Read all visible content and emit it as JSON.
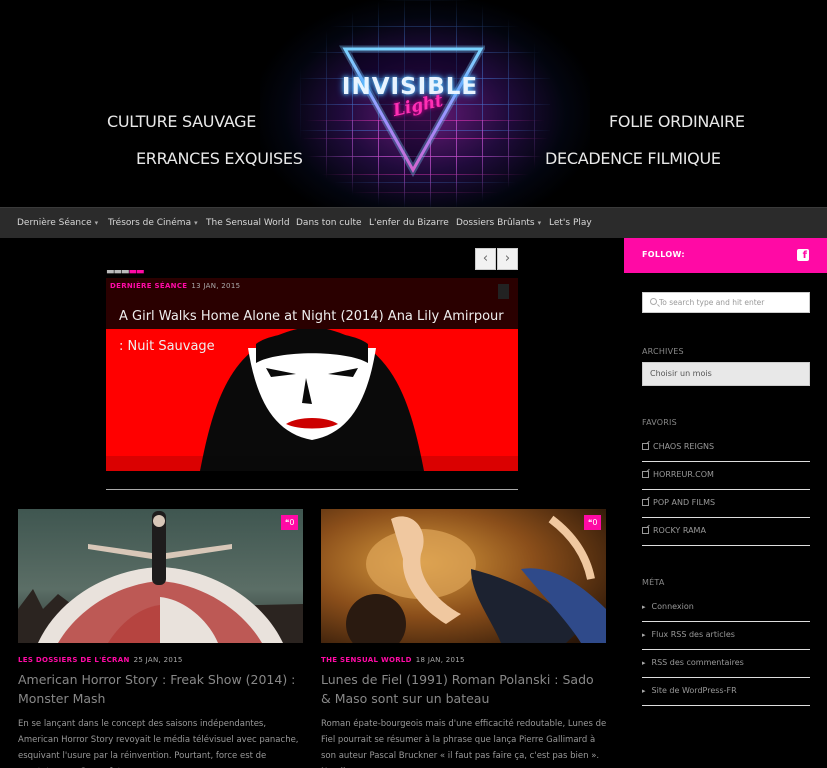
{
  "header": {
    "logo_title": "INVISIBLE",
    "logo_sub": "Light",
    "taglines": {
      "left_top": "CULTURE SAUVAGE",
      "left_bottom": "ERRANCES EXQUISES",
      "right_top": "FOLIE ORDINAIRE",
      "right_bottom": "DECADENCE FILMIQUE"
    }
  },
  "nav": {
    "items": [
      {
        "label": "Dernière Séance",
        "has_dropdown": true
      },
      {
        "label": "Trésors de Cinéma",
        "has_dropdown": true
      },
      {
        "label": "The Sensual World",
        "has_dropdown": false
      },
      {
        "label": "Dans ton culte",
        "has_dropdown": false
      },
      {
        "label": "L'enfer du Bizarre",
        "has_dropdown": false
      },
      {
        "label": "Dossiers Brûlants",
        "has_dropdown": true
      },
      {
        "label": "Let's Play",
        "has_dropdown": false
      }
    ],
    "caret": "▾"
  },
  "slider": {
    "prev_icon": "‹",
    "next_icon": "›",
    "slide": {
      "category": "DERNIÈRE SÉANCE",
      "date": "13 JAN, 2015",
      "title": "A Girl Walks Home Alone at Night (2014) Ana Lily Amirpour : Nuit Sauvage"
    }
  },
  "posts": [
    {
      "category": "LES DOSSIERS DE L'ÉCRAN",
      "date": "25 JAN, 2015",
      "title": "American Horror Story : Freak Show (2014) : Monster Mash",
      "excerpt": "En se lançant dans le concept des saisons indépendantes, American Horror Story revoyait le média télévisuel avec panache, esquivant l'usure par la réinvention. Pourtant, force est de constater que Coven fut",
      "comments": "0"
    },
    {
      "category": "THE SENSUAL WORLD",
      "date": "18 JAN, 2015",
      "title": "Lunes de Fiel (1991) Roman Polanski : Sado & Maso sont sur un bateau",
      "excerpt": "Roman épate-bourgeois mais d'une efficacité redoutable, Lunes de Fiel pourrait se résumer à la phrase que lança Pierre Gallimard à son auteur Pascal Bruckner « il faut pas faire ça, c'est pas bien ». Non il...",
      "comments": "0"
    }
  ],
  "sidebar": {
    "follow_label": "FOLLOW:",
    "facebook_glyph": "f",
    "search_placeholder": "To search type and hit enter",
    "archives_title": "ARCHIVES",
    "archives_select": "Choisir un mois",
    "favoris_title": "FAVORIS",
    "favoris": [
      "CHAOS REIGNS",
      "HORREUR.COM",
      "POP AND FILMS",
      "ROCKY RAMA"
    ],
    "meta_title": "MÉTA",
    "meta_bullet": "▸",
    "meta": [
      "Connexion",
      "Flux RSS des articles",
      "RSS des commentaires",
      "Site de WordPress-FR"
    ]
  },
  "colors": {
    "accent": "#ff0aa5",
    "nav_bg": "#2b2b2b",
    "slide_bg": "#ff0000"
  }
}
